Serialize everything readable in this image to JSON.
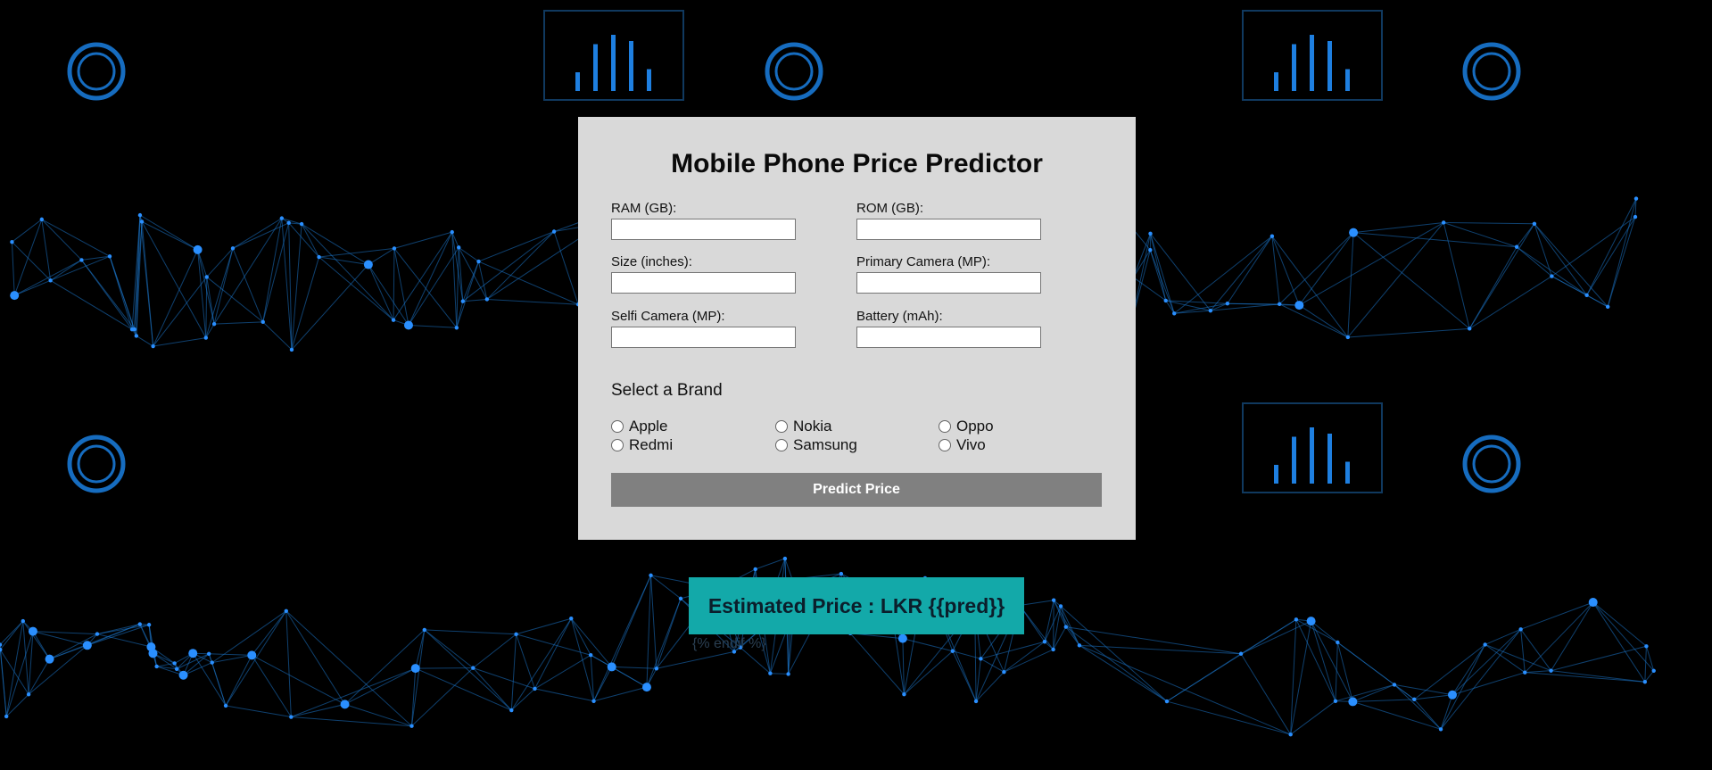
{
  "form": {
    "title": "Mobile Phone Price Predictor",
    "fields": [
      {
        "label": "RAM (GB):",
        "value": ""
      },
      {
        "label": "ROM (GB):",
        "value": ""
      },
      {
        "label": "Size (inches):",
        "value": ""
      },
      {
        "label": "Primary Camera (MP):",
        "value": ""
      },
      {
        "label": "Selfi Camera (MP):",
        "value": ""
      },
      {
        "label": "Battery (mAh):",
        "value": ""
      }
    ],
    "brand_heading": "Select a Brand",
    "brands": [
      "Apple",
      "Nokia",
      "Oppo",
      "Redmi",
      "Samsung",
      "Vivo"
    ],
    "submit_label": "Predict Price"
  },
  "result": {
    "text": "Estimated Price : LKR {{pred}}",
    "endif_text": "{% endif %}"
  },
  "colors": {
    "background": "#000000",
    "card": "#d9d9d9",
    "button": "#808080",
    "result": "#13a9a9",
    "accent_network": "#1e90ff"
  }
}
